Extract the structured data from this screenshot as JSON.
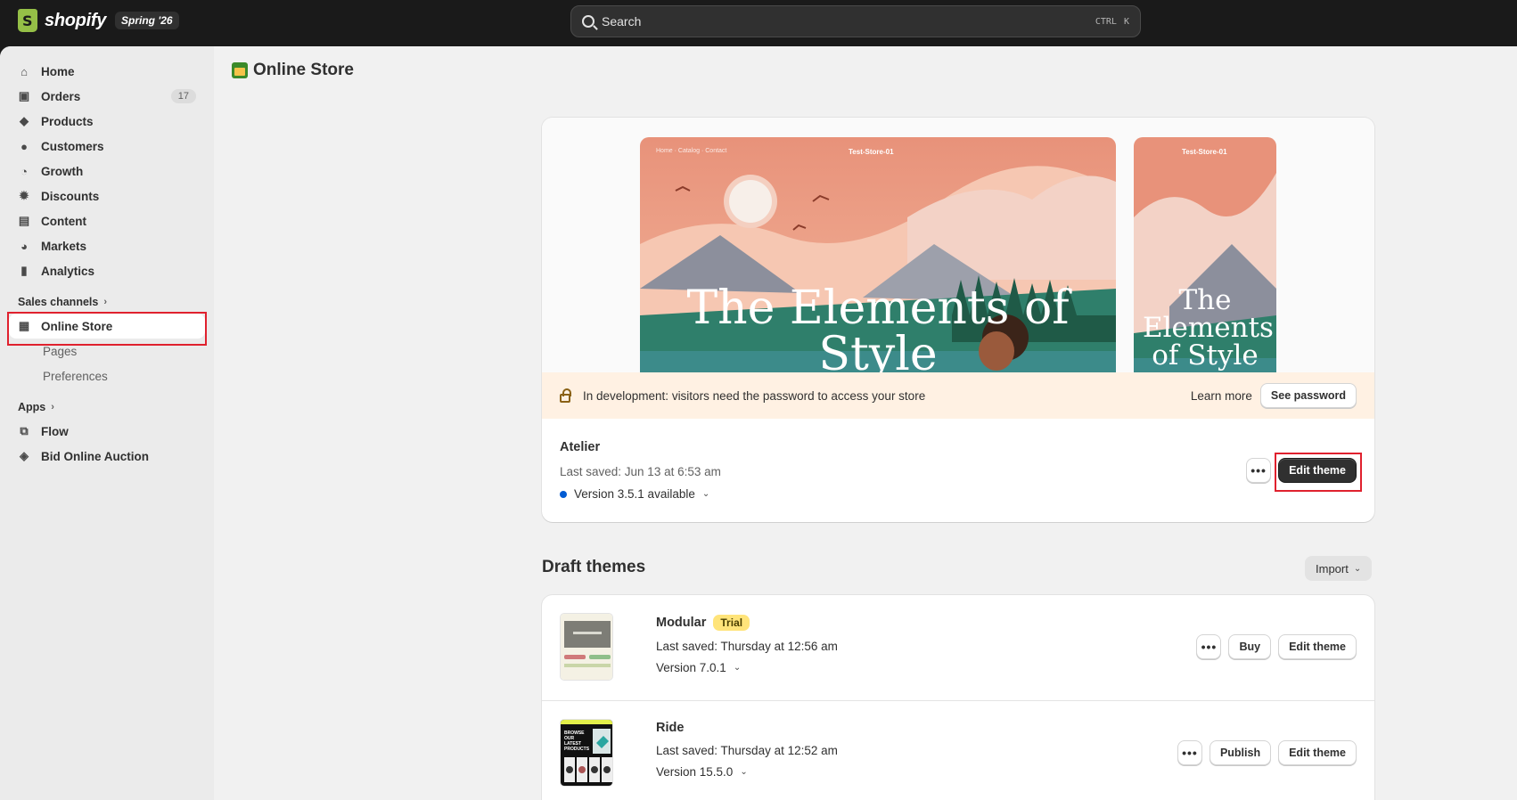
{
  "topbar": {
    "brand": "shopify",
    "edition": "Spring '26",
    "search_placeholder": "Search",
    "shortcut_1": "CTRL",
    "shortcut_2": "K"
  },
  "sidebar": {
    "items": [
      {
        "label": "Home",
        "icon": "home-icon"
      },
      {
        "label": "Orders",
        "icon": "inbox-icon",
        "count": "17"
      },
      {
        "label": "Products",
        "icon": "tag-icon"
      },
      {
        "label": "Customers",
        "icon": "person-icon"
      },
      {
        "label": "Growth",
        "icon": "gauge-icon"
      },
      {
        "label": "Discounts",
        "icon": "discount-icon"
      },
      {
        "label": "Content",
        "icon": "image-icon"
      },
      {
        "label": "Markets",
        "icon": "globe-icon"
      },
      {
        "label": "Analytics",
        "icon": "chart-bar-icon"
      }
    ],
    "sales_channels_label": "Sales channels",
    "online_store_label": "Online Store",
    "sub_items": [
      "Pages",
      "Preferences"
    ],
    "apps_label": "Apps",
    "apps": [
      {
        "label": "Flow",
        "icon": "flow-icon"
      },
      {
        "label": "Bid Online Auction",
        "icon": "auction-icon"
      }
    ]
  },
  "page": {
    "title": "Online Store"
  },
  "live_theme": {
    "preview_heading": "The Elements of Style",
    "preview_store_name": "Test-Store-01",
    "banner_text": "In development: visitors need the password to access your store",
    "learn_more": "Learn more",
    "see_password": "See password",
    "name": "Atelier",
    "last_saved": "Last saved: Jun 13 at 6:53 am",
    "version": "Version 3.5.1 available",
    "edit_theme": "Edit theme",
    "more": "•••"
  },
  "drafts": {
    "title": "Draft themes",
    "import_label": "Import",
    "items": [
      {
        "name": "Modular",
        "badge": "Trial",
        "last_saved": "Last saved: Thursday at 12:56 am",
        "version": "Version 7.0.1",
        "secondary": "Buy",
        "edit": "Edit theme",
        "more": "•••"
      },
      {
        "name": "Ride",
        "last_saved": "Last saved: Thursday at 12:52 am",
        "version": "Version 15.5.0",
        "secondary": "Publish",
        "edit": "Edit theme",
        "more": "•••",
        "thumb_text": "BROWSE OUR LATEST PRODUCTS"
      }
    ]
  },
  "colors": {
    "highlight": "#e0212e",
    "accent": "#005bd3",
    "trial_badge": "#ffe47a",
    "banner": "#fff1e3"
  }
}
